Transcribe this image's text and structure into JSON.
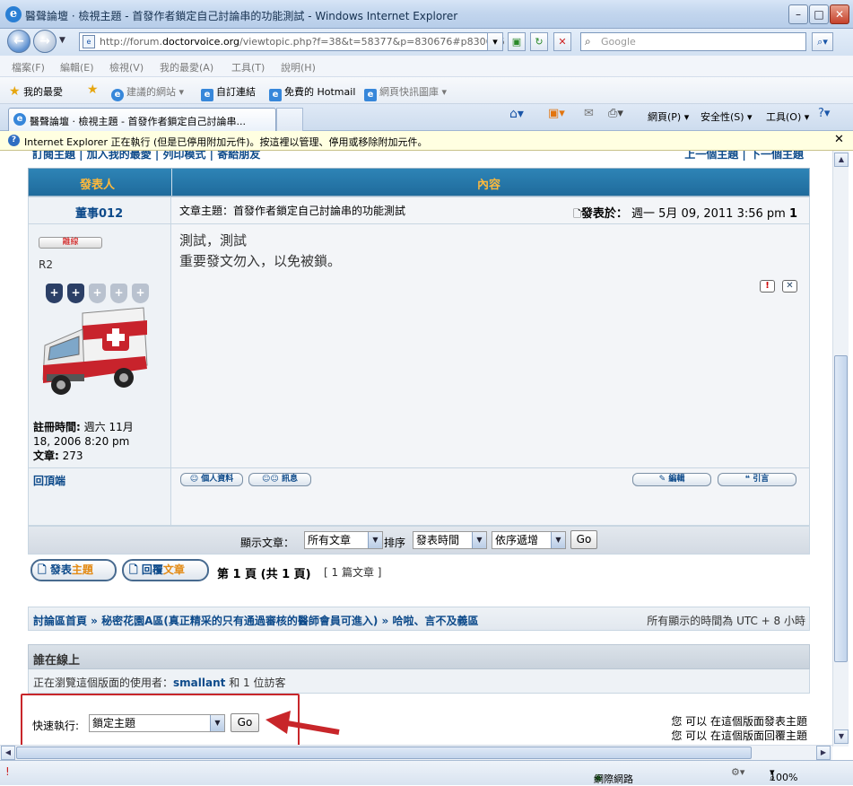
{
  "window": {
    "title": "醫聲論壇 · 檢視主題 - 首發作者鎖定自己討論串的功能測試 - Windows Internet Explorer"
  },
  "address": {
    "url_prefix": "http://forum.",
    "url_domain": "doctorvoice.org",
    "url_suffix": "/viewtopic.php?f=38&t=58377&p=830676#p830676"
  },
  "search": {
    "placeholder": "Google"
  },
  "menu": [
    "檔案(F)",
    "編輯(E)",
    "檢視(V)",
    "我的最愛(A)",
    "工具(T)",
    "說明(H)"
  ],
  "favorites": {
    "label": "我的最愛",
    "items": [
      "建議的網站 ▾",
      "自訂連結",
      "免費的 Hotmail",
      "網頁快訊圖庫 ▾"
    ]
  },
  "tab": {
    "title": "醫聲論壇 · 檢視主題 - 首發作者鎖定自己討論串..."
  },
  "commands": [
    "網頁(P) ▾",
    "安全性(S) ▾",
    "工具(O) ▾"
  ],
  "infobar": {
    "text": "Internet Explorer 正在執行 (但是已停用附加元件)。按這裡以管理、停用或移除附加元件。"
  },
  "forum": {
    "top_links_left": "訂閱主題 | 加入我的最愛 | 列印模式 | 寄給朋友",
    "top_links_right": "上一個主題 | 下一個主題",
    "col_author": "發表人",
    "col_content": "內容",
    "author": "董事012",
    "subject": "文章主題：首發作者鎖定自己討論串的功能測試",
    "posted_label": "發表於：",
    "posted_date": "週一 5月 09, 2011 3:56 pm",
    "post_number": "1",
    "message_line1": "測試，測試",
    "message_line2": "重要發文勿入，以免被鎖。",
    "status_badge": "離線",
    "rank": "R2",
    "reg_label": "註冊時間:",
    "reg_value_1": "週六 11月",
    "reg_value_2": "18, 2006 8:20 pm",
    "posts_label": "文章:",
    "posts_value": "273",
    "back_to_top": "回頂端",
    "btn_profile": "個人資料",
    "btn_pm": "訊息",
    "btn_edit": "編輯",
    "btn_quote": "引言",
    "display_label": "顯示文章：",
    "display_value": "所有文章",
    "sort_label": "排序",
    "sort_value": "發表時間",
    "order_value": "依序遞增",
    "go": "Go",
    "btn_new_topic_1": "發表",
    "btn_new_topic_2": "主題",
    "btn_reply_1": "回覆",
    "btn_reply_2": "文章",
    "page_info": "第 1 頁 (共 1 頁)",
    "post_count": "[ 1 篇文章 ]",
    "breadcrumb": "討論區首頁 » 秘密花園A區(真正精采的只有通過審核的醫師會員可進入) » 哈啦、言不及義區",
    "timezone": "所有顯示的時間為 UTC + 8 小時",
    "online_title": "誰在線上",
    "online_prefix": "正在瀏覽這個版面的使用者：",
    "online_user": "smallant",
    "online_suffix": "和 1 位訪客",
    "quick_label": "快速執行:",
    "quick_value": "鎖定主題",
    "perm1": "您 可以 在這個版面發表主題",
    "perm2": "您 可以 在這個版面回覆主題"
  },
  "status": {
    "zone": "網際網路",
    "zoom": "100%"
  }
}
